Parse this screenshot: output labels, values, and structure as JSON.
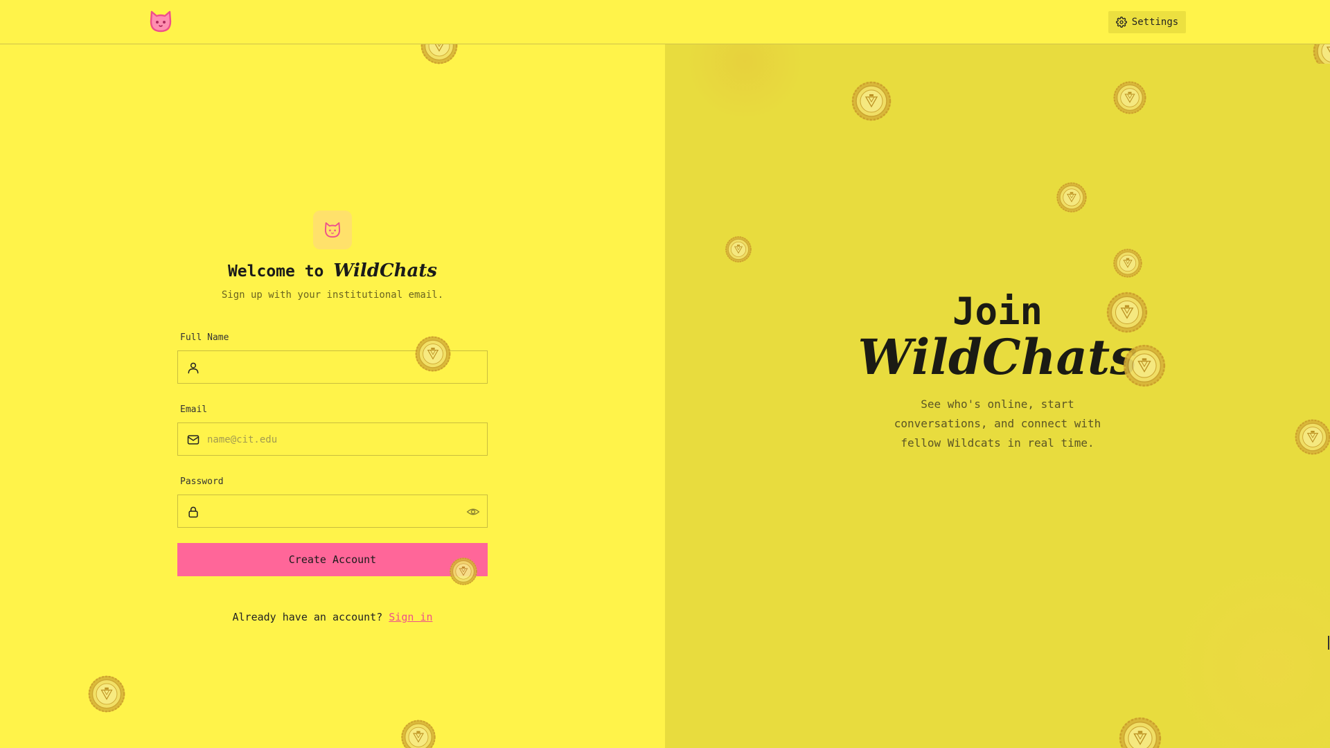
{
  "app": {
    "name": "WildChats"
  },
  "header": {
    "settings_label": "Settings"
  },
  "form": {
    "welcome_prefix": "Welcome to",
    "welcome_brand": "WildChats",
    "subtitle": "Sign up with your institutional email.",
    "full_name": {
      "label": "Full Name",
      "value": "",
      "placeholder": ""
    },
    "email": {
      "label": "Email",
      "value": "",
      "placeholder": "name@cit.edu"
    },
    "password": {
      "label": "Password",
      "value": "",
      "placeholder": ""
    },
    "submit_label": "Create Account",
    "signin_prompt": "Already have an account?",
    "signin_link": "Sign in"
  },
  "hero": {
    "join": "Join",
    "brand": "WildChats",
    "description": "See who's online, start conversations, and connect with fellow Wildcats in real time."
  },
  "colors": {
    "background": "#fff34a",
    "panel": "#e8dc3e",
    "accent_pink": "#ff6699",
    "link_pink": "#ee4f8c"
  },
  "icons": [
    "cat-logo-icon",
    "gear-icon",
    "user-icon",
    "mail-icon",
    "lock-icon",
    "eye-icon",
    "seal-icon"
  ]
}
